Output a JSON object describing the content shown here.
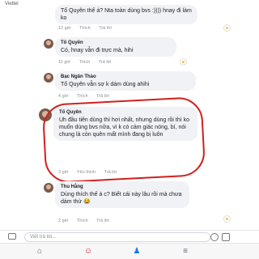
{
  "statusbar": {
    "carrier": "Viettel",
    "time": ""
  },
  "comments": [
    {
      "name": "",
      "text": "Tố Quyên thế á? Nta toàn dùng bvs :)))) hnay đi làm ko",
      "time": "12 giờ",
      "like": "Thích",
      "reply": "Trả lời"
    },
    {
      "name": "Tố Quyên",
      "text": "Có, hnay vẫn đi trực mà, hihi",
      "time": "11 giờ",
      "like": "Thích",
      "reply": "Trả lời"
    },
    {
      "name": "Bạc Ngân Thảo",
      "text": "Tố Quyên vẫn sợ k dám dùng ahihi",
      "time": "4 giờ",
      "like": "Thích",
      "reply": "Trả lời"
    },
    {
      "name": "Tố Quyên",
      "text": "Uh đầu tiên dùng thì hơi nhất, nhưng dùng rồi thì ko muốn dùng bvs nữa, vì k có cảm giác nóng, bí, nói chung là còn quên mất mình đang bị luôn",
      "time": "3 giờ",
      "like": "Yêu thích",
      "reply": "Trả lời"
    },
    {
      "name": "Thu Hằng",
      "text": "Dùng thích thế à c? Biết cái này lâu rồi mà chưa dám thử 😂",
      "time": "2 giờ",
      "like": "Thích",
      "reply": "Trả lời"
    }
  ],
  "composer": {
    "placeholder": "Viết trả lời..."
  },
  "nav": {
    "home": "⌂",
    "reactions": "☺",
    "notifications": "♟",
    "menu": "≡"
  },
  "colors": {
    "highlight": "#d0201e",
    "bubble": "#f0f2f5"
  }
}
